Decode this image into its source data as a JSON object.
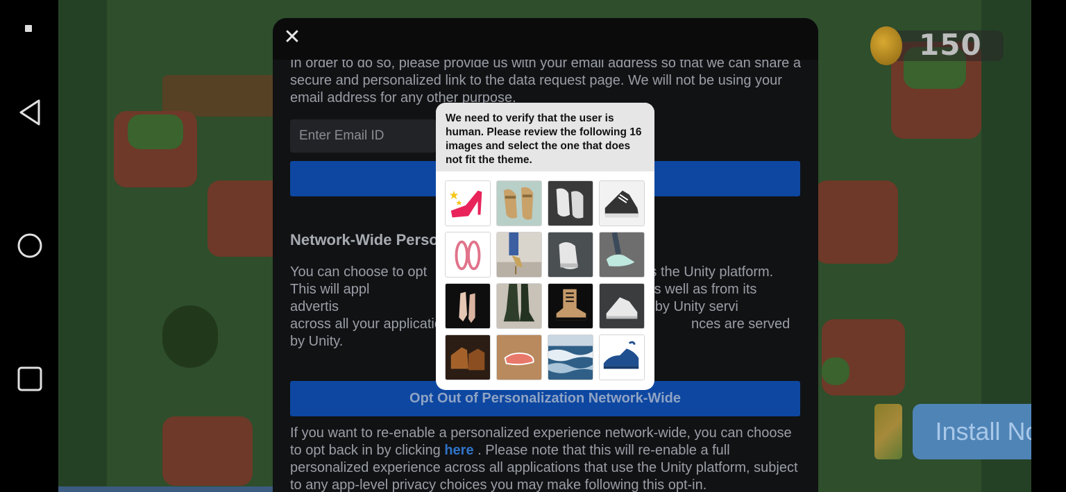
{
  "navbar": {
    "back_icon": "back-triangle-icon",
    "home_icon": "home-circle-icon",
    "recents_icon": "recents-square-icon"
  },
  "game": {
    "coins": "150",
    "install_label": "Install Now"
  },
  "dialog": {
    "close_glyph": "✕",
    "intro_text": "In order to do so, please provide us with your email address so that we can share a secure and personalized link to the data request page. We will not be using your email address for any other purpose.",
    "email_placeholder": "Enter Email ID",
    "section_heading": "Network-Wide Perso",
    "optout_text": "You can choose to opt                                              e across the Unity platform. This will appl                                           rom Unity directly as well as from its advertis                                        zed experiences provided by Unity servi                                               across all your applications to the exte                                           nces are served by Unity.",
    "optout_label": "Opt Out of Personalization Network-Wide",
    "reenable_before": "If you want to re-enable a personalized experience network-wide, you can choose to opt back in by clicking ",
    "reenable_link": "here",
    "reenable_after": " . Please note that this will re-enable a full personalized experience across all applications that use the Unity platform, subject to any app-level privacy choices you may make following this opt-in."
  },
  "captcha": {
    "prompt": "We need to verify that the user is human. Please review the following 16 images and select the one that does not fit the theme.",
    "images": [
      "red-high-heel-icon",
      "tan-sandals-icon",
      "white-sneakers-icon",
      "bw-converse-icon",
      "pink-flats-icon",
      "gold-heels-icon",
      "white-hightop-icon",
      "mint-sneakers-icon",
      "nude-heels-icon",
      "green-boots-icon",
      "brown-boot-icon",
      "white-converse-icon",
      "leather-boots-icon",
      "salmon-shoe-icon",
      "ocean-waves-icon",
      "blue-sneaker-icon"
    ]
  },
  "colors": {
    "primary_button": "#0d47a1",
    "link": "#2f73c9",
    "install_button": "#4f84b7"
  }
}
